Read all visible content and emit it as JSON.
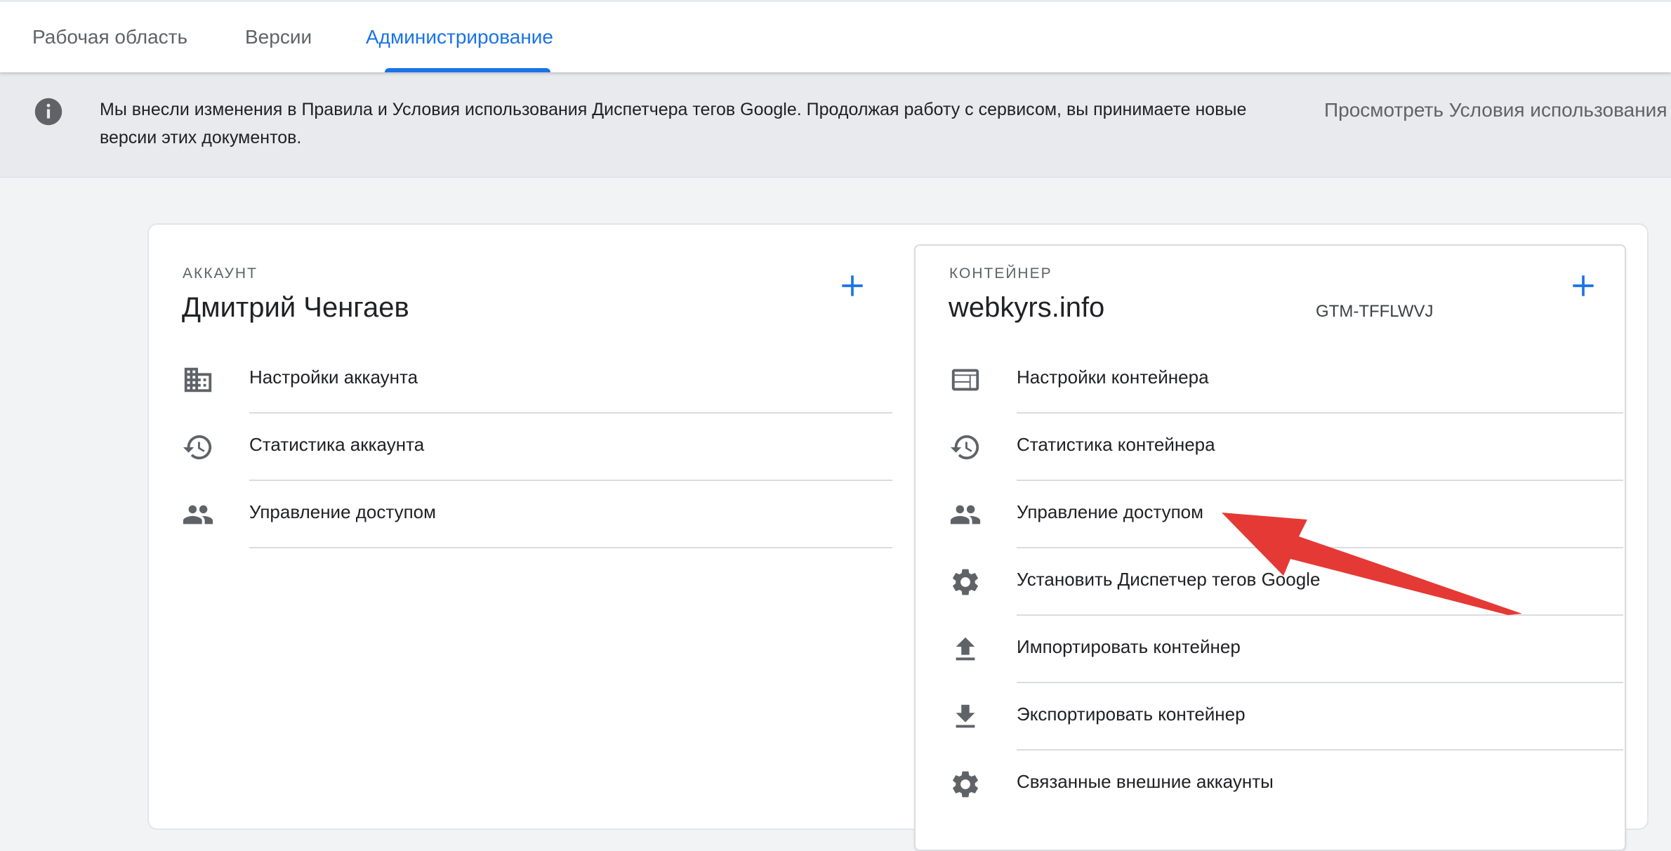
{
  "tabs": [
    {
      "label": "Рабочая область",
      "active": false
    },
    {
      "label": "Версии",
      "active": false
    },
    {
      "label": "Администрирование",
      "active": true
    }
  ],
  "banner": {
    "icon": "info-icon",
    "text": "Мы внесли изменения в Правила и Условия использования Диспетчера тегов Google. Продолжая работу с сервисом, вы принимаете новые версии этих документов.",
    "link": "Просмотреть Условия использования"
  },
  "account": {
    "section_label": "АККАУНТ",
    "name": "Дмитрий Ченгаев",
    "items": [
      {
        "label": "Настройки аккаунта",
        "icon": "building-icon"
      },
      {
        "label": "Статистика аккаунта",
        "icon": "history-icon"
      },
      {
        "label": "Управление доступом",
        "icon": "people-icon"
      }
    ]
  },
  "container": {
    "section_label": "КОНТЕЙНЕР",
    "name": "webkyrs.info",
    "id": "GTM-TFFLWVJ",
    "items": [
      {
        "label": "Настройки контейнера",
        "icon": "web-layout-icon"
      },
      {
        "label": "Статистика контейнера",
        "icon": "history-icon"
      },
      {
        "label": "Управление доступом",
        "icon": "people-icon"
      },
      {
        "label": "Установить Диспетчер тегов Google",
        "icon": "gear-icon"
      },
      {
        "label": "Импортировать контейнер",
        "icon": "upload-icon"
      },
      {
        "label": "Экспортировать контейнер",
        "icon": "download-icon"
      },
      {
        "label": "Связанные внешние аккаунты",
        "icon": "gear-icon"
      }
    ]
  },
  "colors": {
    "accent": "#1a73e8",
    "annotation_arrow": "#e53935",
    "icon_gray": "#5f6368"
  }
}
